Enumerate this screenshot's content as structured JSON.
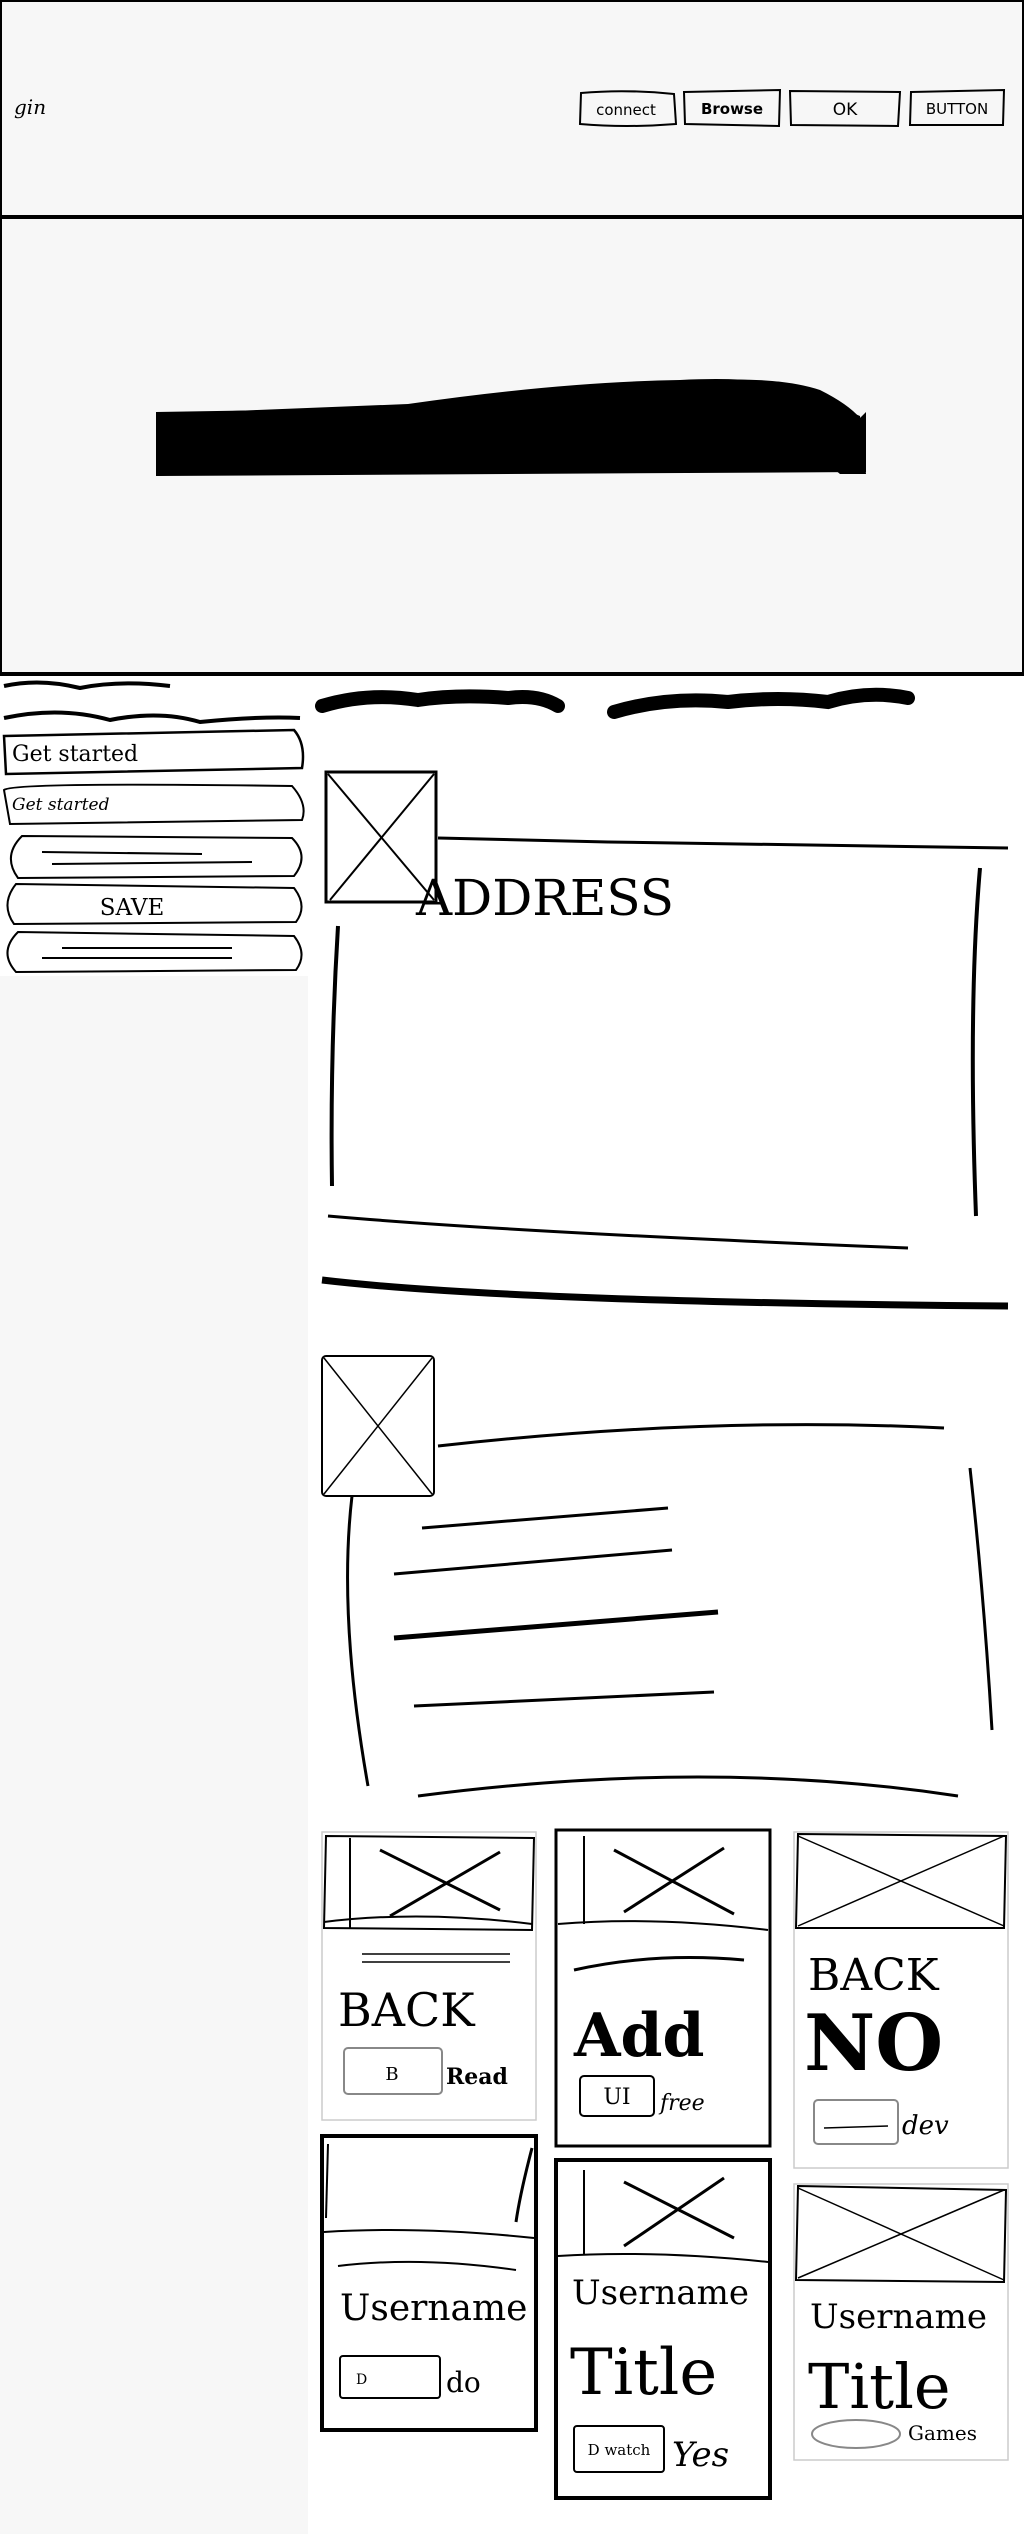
{
  "header": {
    "logo_text": "gin",
    "buttons": [
      "connect",
      "Browse",
      "OK",
      "BUTTON"
    ]
  },
  "sidebar": {
    "items": [
      {
        "label": "Get started"
      },
      {
        "label": "Get started"
      },
      {
        "label": ""
      },
      {
        "label": "SAVE"
      },
      {
        "label": ""
      }
    ]
  },
  "main": {
    "section1": {
      "card_heading": "ADDRESS"
    },
    "cards": [
      {
        "title": "BACK",
        "button": "B",
        "caption": "Read"
      },
      {
        "title": "Add",
        "button": "UI",
        "caption": "free"
      },
      {
        "subtitle": "BACK",
        "title": "NO",
        "caption": "dev"
      },
      {
        "title": "Username",
        "button": "D",
        "caption": "do"
      },
      {
        "title": "Username",
        "subtitle": "Title",
        "button": "D watch",
        "caption": "Yes"
      },
      {
        "title": "Username",
        "subtitle": "Title",
        "caption": "Games"
      }
    ]
  }
}
